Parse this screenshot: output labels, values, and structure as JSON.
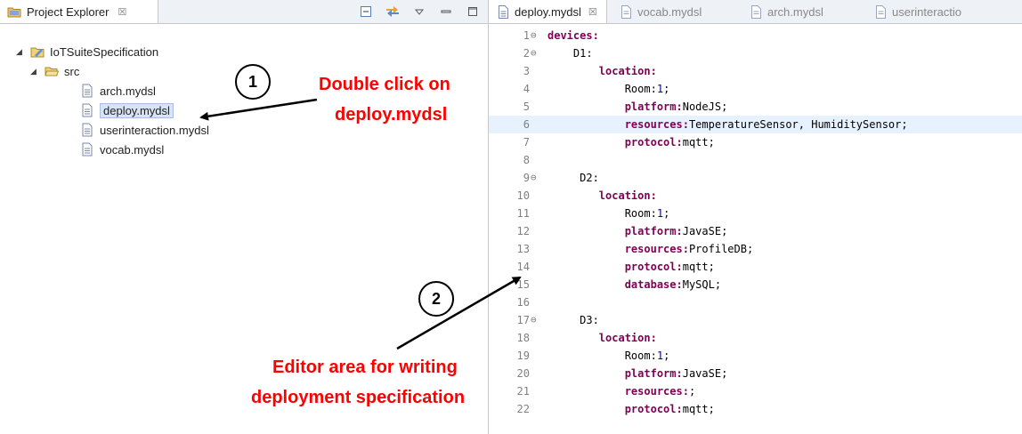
{
  "explorer": {
    "tab_label": "Project Explorer",
    "tab_close": "☒",
    "toolbar_icons": [
      "collapse-all-icon",
      "link-with-editor-icon",
      "view-menu-icon",
      "minimize-icon",
      "maximize-icon"
    ],
    "tree": {
      "project": "IoTSuiteSpecification",
      "folder": "src",
      "files": [
        "arch.mydsl",
        "deploy.mydsl",
        "userinteraction.mydsl",
        "vocab.mydsl"
      ],
      "selected_file": "deploy.mydsl"
    }
  },
  "editor": {
    "tabs": [
      {
        "label": "deploy.mydsl",
        "close": "☒",
        "active": true
      },
      {
        "label": "vocab.mydsl",
        "active": false
      },
      {
        "label": "arch.mydsl",
        "active": false
      },
      {
        "label": "userinteractio",
        "active": false
      }
    ],
    "lines": [
      {
        "n": "1",
        "fold": "⊖",
        "parts": [
          [
            "kw",
            "devices:"
          ]
        ]
      },
      {
        "n": "2",
        "fold": "⊖",
        "parts": [
          [
            "txt",
            "    D1:"
          ]
        ]
      },
      {
        "n": "3",
        "fold": "",
        "parts": [
          [
            "kw",
            "        location:"
          ]
        ]
      },
      {
        "n": "4",
        "fold": "",
        "parts": [
          [
            "txt",
            "            Room:"
          ],
          [
            "num",
            "1"
          ],
          [
            "txt",
            ";"
          ]
        ]
      },
      {
        "n": "5",
        "fold": "",
        "parts": [
          [
            "kw",
            "            platform:"
          ],
          [
            "txt",
            "NodeJS;"
          ]
        ]
      },
      {
        "n": "6",
        "fold": "",
        "hl": true,
        "parts": [
          [
            "kw",
            "            resources:"
          ],
          [
            "txt",
            "TemperatureSensor, HumiditySensor;"
          ]
        ]
      },
      {
        "n": "7",
        "fold": "",
        "parts": [
          [
            "kw",
            "            protocol:"
          ],
          [
            "txt",
            "mqtt;"
          ]
        ]
      },
      {
        "n": "8",
        "fold": "",
        "parts": []
      },
      {
        "n": "9",
        "fold": "⊖",
        "parts": [
          [
            "txt",
            "     D2:"
          ]
        ]
      },
      {
        "n": "10",
        "fold": "",
        "parts": [
          [
            "kw",
            "        location:"
          ]
        ]
      },
      {
        "n": "11",
        "fold": "",
        "parts": [
          [
            "txt",
            "            Room:"
          ],
          [
            "num",
            "1"
          ],
          [
            "txt",
            ";"
          ]
        ]
      },
      {
        "n": "12",
        "fold": "",
        "parts": [
          [
            "kw",
            "            platform:"
          ],
          [
            "txt",
            "JavaSE;"
          ]
        ]
      },
      {
        "n": "13",
        "fold": "",
        "parts": [
          [
            "kw",
            "            resources:"
          ],
          [
            "txt",
            "ProfileDB;"
          ]
        ]
      },
      {
        "n": "14",
        "fold": "",
        "parts": [
          [
            "kw",
            "            protocol:"
          ],
          [
            "txt",
            "mqtt;"
          ]
        ]
      },
      {
        "n": "15",
        "fold": "",
        "parts": [
          [
            "kw",
            "            database:"
          ],
          [
            "txt",
            "MySQL;"
          ]
        ]
      },
      {
        "n": "16",
        "fold": "",
        "parts": []
      },
      {
        "n": "17",
        "fold": "⊖",
        "parts": [
          [
            "txt",
            "     D3:"
          ]
        ]
      },
      {
        "n": "18",
        "fold": "",
        "parts": [
          [
            "kw",
            "        location:"
          ]
        ]
      },
      {
        "n": "19",
        "fold": "",
        "parts": [
          [
            "txt",
            "            Room:"
          ],
          [
            "num",
            "1"
          ],
          [
            "txt",
            ";"
          ]
        ]
      },
      {
        "n": "20",
        "fold": "",
        "parts": [
          [
            "kw",
            "            platform:"
          ],
          [
            "txt",
            "JavaSE;"
          ]
        ]
      },
      {
        "n": "21",
        "fold": "",
        "parts": [
          [
            "kw",
            "            resources:"
          ],
          [
            "txt",
            ";"
          ]
        ]
      },
      {
        "n": "22",
        "fold": "",
        "parts": [
          [
            "kw",
            "            protocol:"
          ],
          [
            "txt",
            "mqtt;"
          ]
        ]
      }
    ]
  },
  "annotations": {
    "step1_number": "1",
    "step1_line1": "Double click on",
    "step1_line2": "deploy.mydsl",
    "step2_number": "2",
    "step2_line1": "Editor area for writing",
    "step2_line2": "deployment  specification"
  },
  "colors": {
    "annotation": "#ff0000",
    "keyword": "#7f0055",
    "number": "#0000c0",
    "current_line": "#e8f2fe"
  }
}
